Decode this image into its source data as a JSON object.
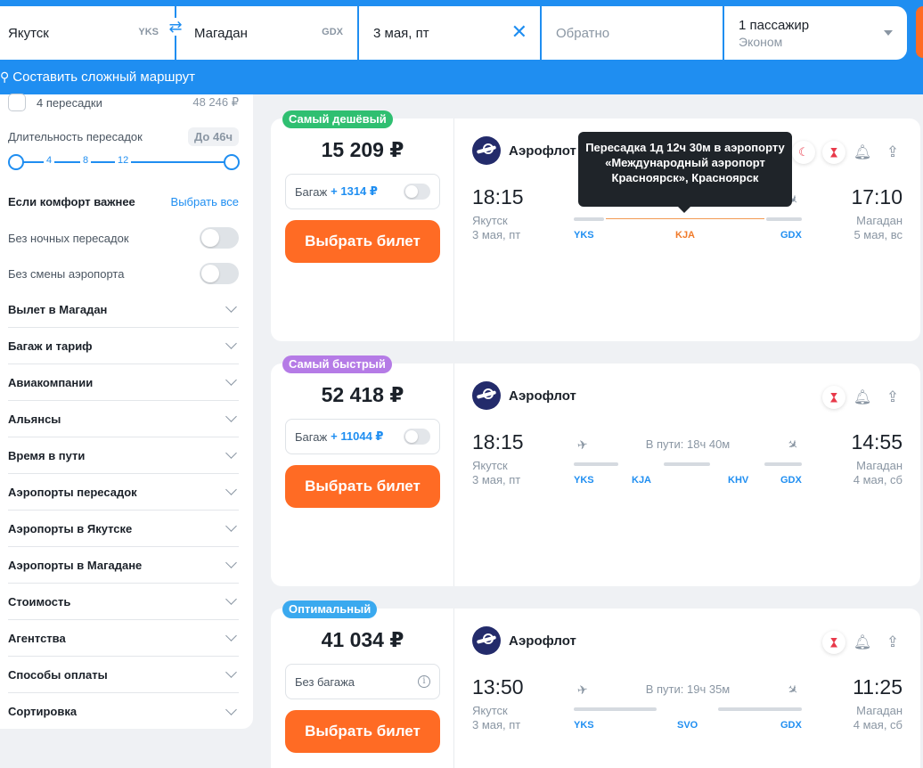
{
  "search": {
    "from_city": "Якутск",
    "from_code": "YKS",
    "to_city": "Магадан",
    "to_code": "GDX",
    "date": "3 мая, пт",
    "return_placeholder": "Обратно",
    "passengers": "1 пассажир",
    "cabin": "Эконом",
    "complex_route": "Составить сложный маршрут"
  },
  "filters": {
    "stops_label": "4 пересадки",
    "stops_price": "48 246 ₽",
    "layover_label": "Длительность пересадок",
    "layover_value": "До 46ч",
    "slider_ticks": [
      "4",
      "8",
      "12"
    ],
    "comfort_title": "Если комфорт важнее",
    "select_all": "Выбрать все",
    "no_night": "Без ночных пересадок",
    "no_airport_change": "Без смены аэропорта",
    "sections": [
      "Вылет в Магадан",
      "Багаж и тариф",
      "Авиакомпании",
      "Альянсы",
      "Время в пути",
      "Аэропорты пересадок",
      "Аэропорты в Якутске",
      "Аэропорты в Магадане",
      "Стоимость",
      "Агентства",
      "Способы оплаты",
      "Сортировка"
    ]
  },
  "tooltip": "Пересадка 1д 12ч 30м в аэропорту «Международный аэропорт Красноярск», Красноярск",
  "buy_label": "Выбрать билет",
  "cards": [
    {
      "badge": "Самый дешёвый",
      "badge_color": "#2fbf71",
      "price": "15 209 ₽",
      "bag_label": "Багаж",
      "bag_price": "+ 1314 ₽",
      "airline": "Аэрофлот",
      "dep_time": "18:15",
      "dep_city": "Якутск",
      "dep_date": "3 мая, пт",
      "arr_time": "17:10",
      "arr_city": "Магадан",
      "arr_date": "5 мая, вс",
      "codes": [
        "YKS",
        "KJA",
        "GDX"
      ]
    },
    {
      "badge": "Самый быстрый",
      "badge_color": "#b57be6",
      "price": "52 418 ₽",
      "bag_label": "Багаж",
      "bag_price": "+ 11044 ₽",
      "airline": "Аэрофлот",
      "duration": "В пути: 18ч 40м",
      "dep_time": "18:15",
      "dep_city": "Якутск",
      "dep_date": "3 мая, пт",
      "arr_time": "14:55",
      "arr_city": "Магадан",
      "arr_date": "4 мая, сб",
      "codes": [
        "YKS",
        "KJA",
        "KHV",
        "GDX"
      ]
    },
    {
      "badge": "Оптимальный",
      "badge_color": "#3aa9ef",
      "price": "41 034 ₽",
      "bag_label": "Без багажа",
      "airline": "Аэрофлот",
      "duration": "В пути: 19ч 35м",
      "dep_time": "13:50",
      "dep_city": "Якутск",
      "dep_date": "3 мая, пт",
      "arr_time": "11:25",
      "arr_city": "Магадан",
      "arr_date": "4 мая, сб",
      "codes": [
        "YKS",
        "SVO",
        "GDX"
      ]
    }
  ]
}
